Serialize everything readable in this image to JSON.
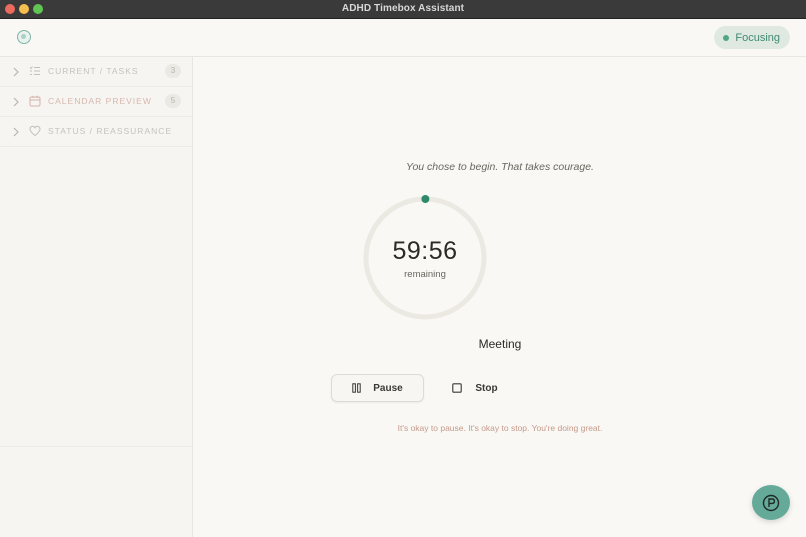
{
  "window": {
    "title": "ADHD Timebox Assistant"
  },
  "header": {
    "status_label": "Focusing"
  },
  "sidebar": {
    "items": [
      {
        "label": "CURRENT / TASKS",
        "count": "3",
        "icon": "list-icon"
      },
      {
        "label": "CALENDAR PREVIEW",
        "count": "5",
        "icon": "calendar-icon"
      },
      {
        "label": "STATUS / REASSURANCE",
        "icon": "heart-icon"
      }
    ]
  },
  "timer": {
    "affirmation": "You chose to begin. That takes courage.",
    "time": "59:56",
    "remaining_label": "remaining",
    "task_name": "Meeting",
    "progress_fraction": 0.001
  },
  "controls": {
    "pause_label": "Pause",
    "stop_label": "Stop"
  },
  "reassurance": "It's okay to pause. It's okay to stop. You're doing great.",
  "colors": {
    "accent": "#4a9a7e",
    "ring_track": "#ece8e2",
    "fab": "#65a998",
    "reassure": "#c79a8a"
  }
}
